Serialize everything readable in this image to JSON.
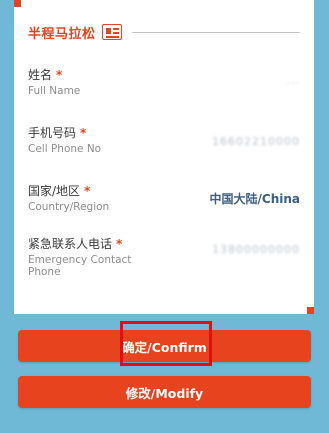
{
  "section": {
    "title": "半程马拉松",
    "badge_icon": "race-badge-icon"
  },
  "fields": {
    "name": {
      "label_cn": "姓名",
      "label_en": "Full Name",
      "required": "*",
      "value": "..."
    },
    "phone": {
      "label_cn": "手机号码",
      "label_en": "Cell Phone No",
      "required": "*",
      "value": "16602210000"
    },
    "country": {
      "label_cn": "国家/地区",
      "label_en": "Country/Region",
      "required": "*",
      "value": "中国大陆/China"
    },
    "emergency": {
      "label_cn": "紧急联系人电话",
      "label_en_1": "Emergency Contact",
      "label_en_2": "Phone",
      "required": "*",
      "value": "13800000000"
    }
  },
  "buttons": {
    "confirm": "确定/Confirm",
    "modify": "修改/Modify"
  },
  "colors": {
    "accent": "#e8431f",
    "background": "#6fb9d6",
    "country_value": "#3d5f84",
    "highlight": "#e01010"
  }
}
